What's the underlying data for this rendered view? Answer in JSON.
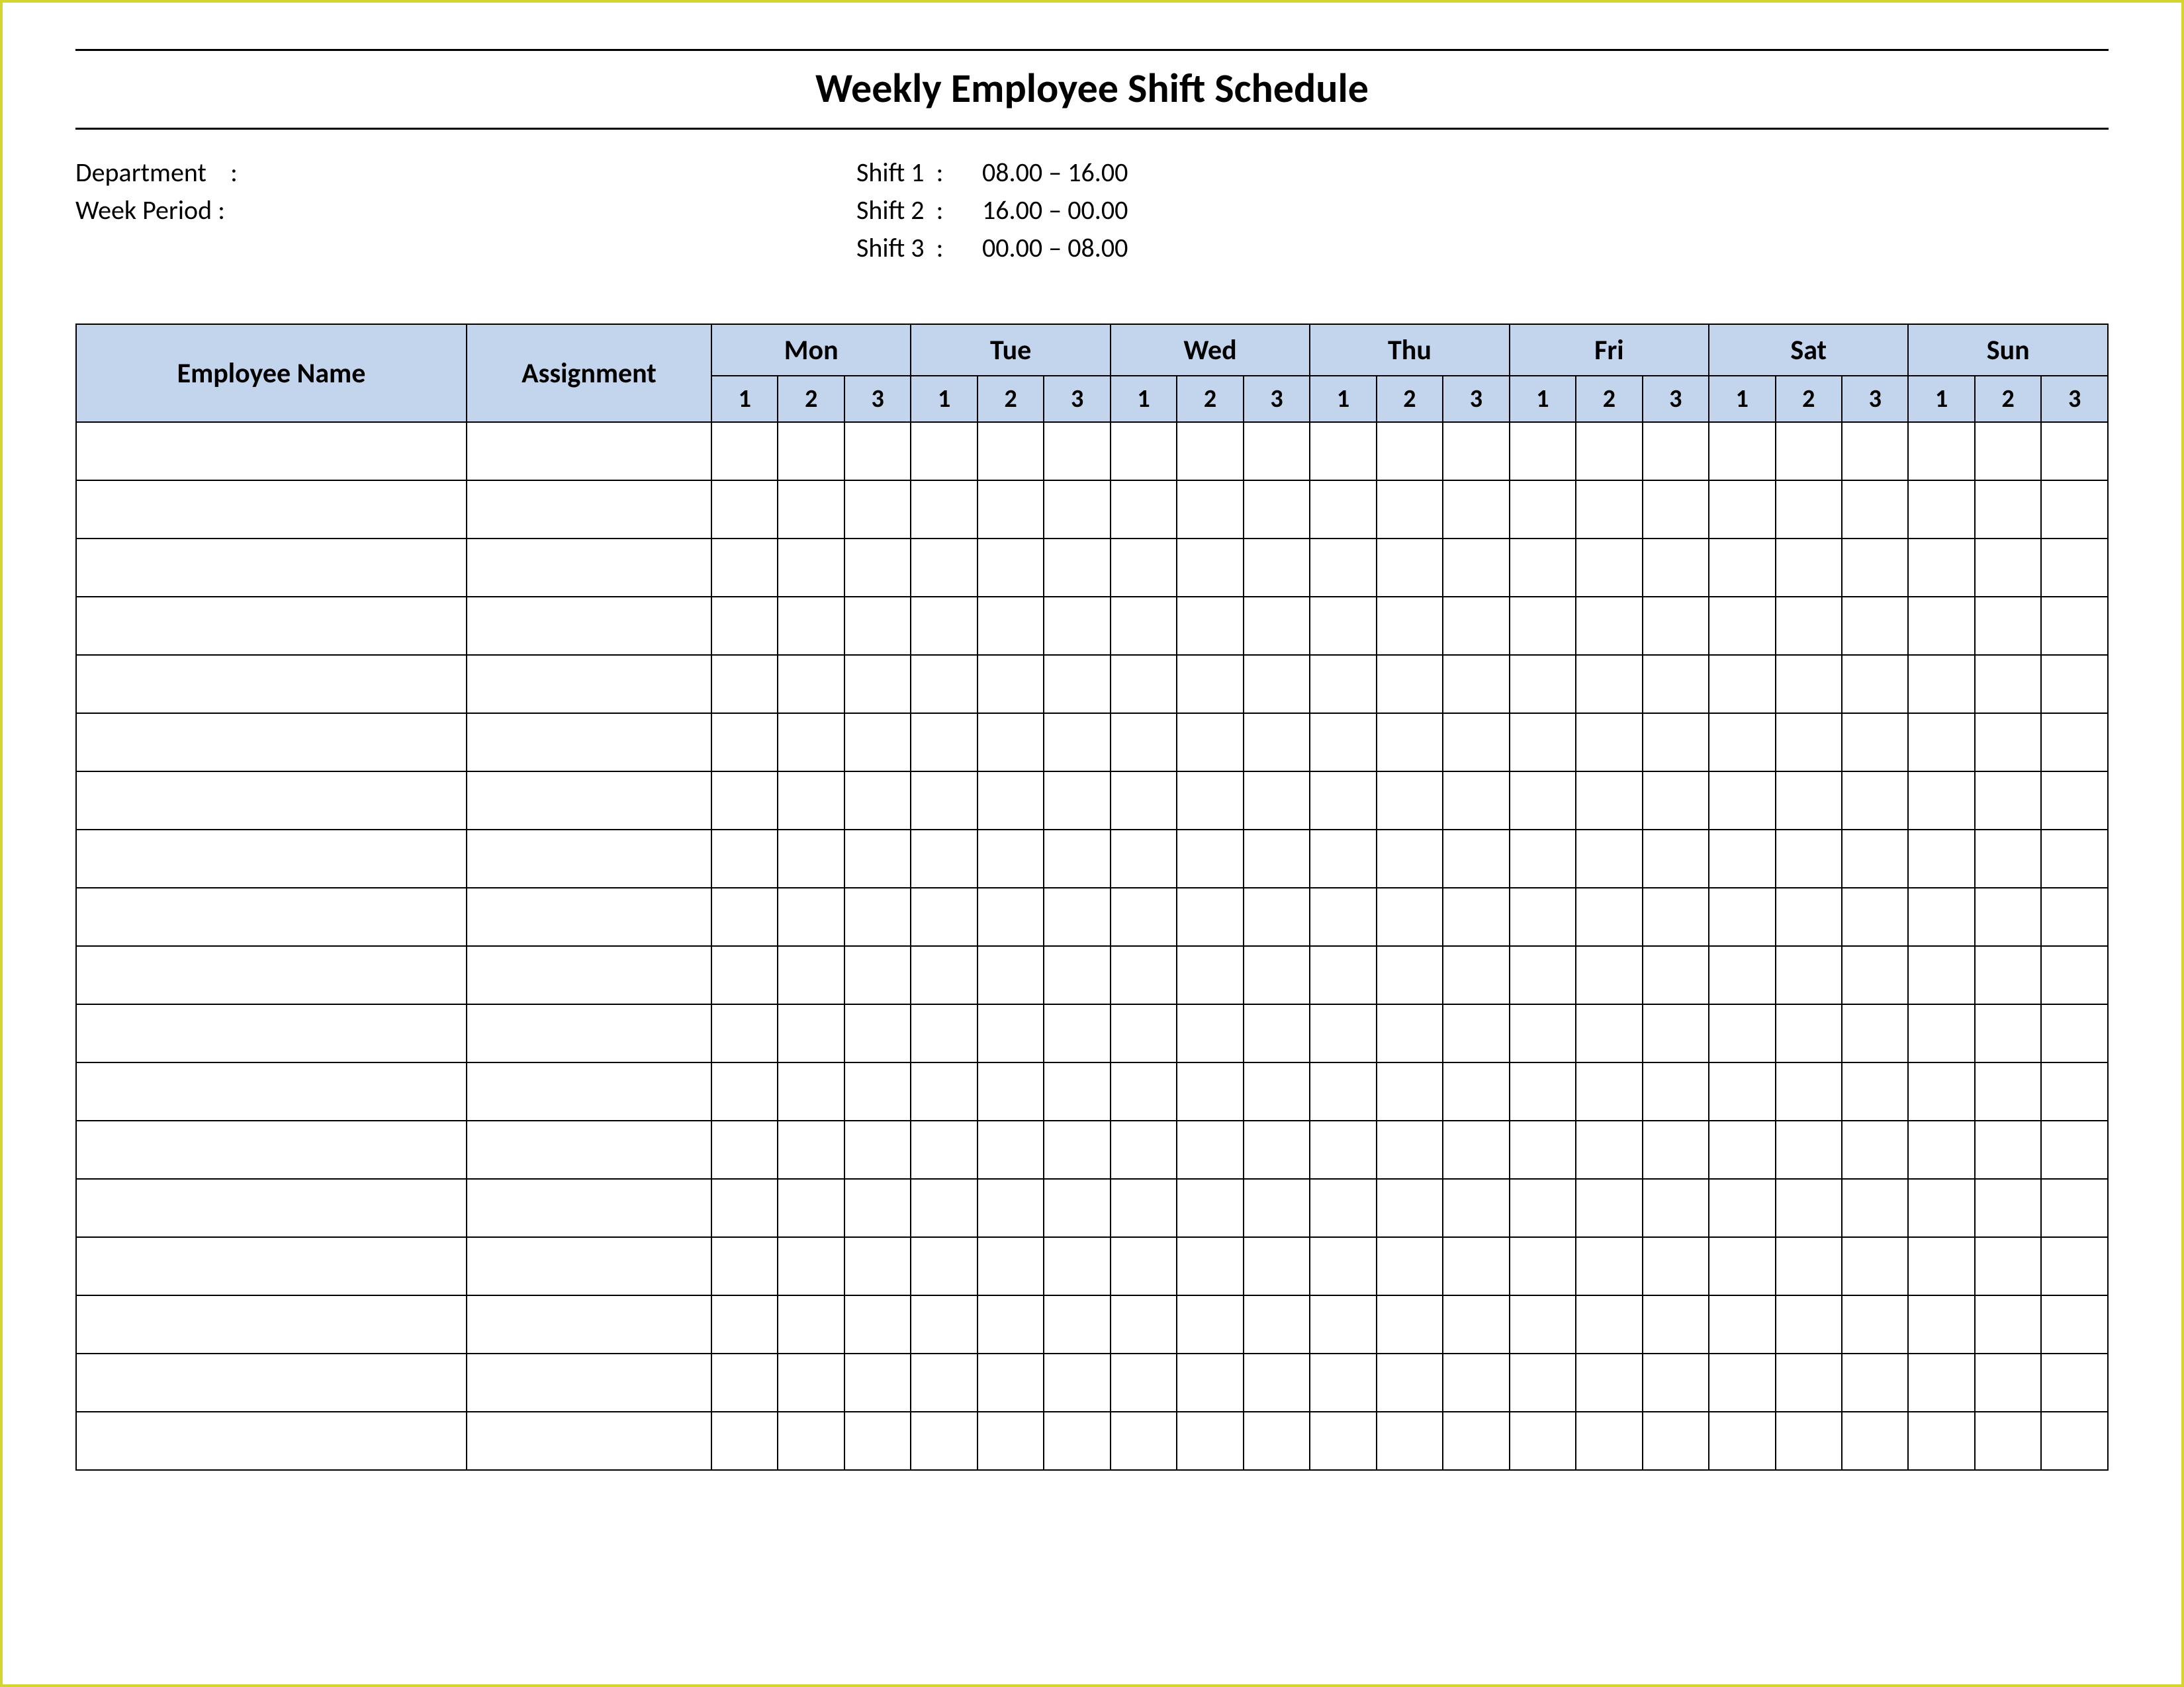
{
  "title": "Weekly Employee Shift Schedule",
  "meta": {
    "department_label": "Department",
    "department_value": "",
    "week_period_label": "Week  Period",
    "week_period_value": "",
    "shifts": [
      {
        "label": "Shift 1",
        "time": "08.00  – 16.00"
      },
      {
        "label": "Shift 2",
        "time": "16.00  – 00.00"
      },
      {
        "label": "Shift 3",
        "time": "00.00  – 08.00"
      }
    ]
  },
  "columns": {
    "employee_name": "Employee Name",
    "assignment": "Assignment",
    "days": [
      "Mon",
      "Tue",
      "Wed",
      "Thu",
      "Fri",
      "Sat",
      "Sun"
    ],
    "subshifts": [
      "1",
      "2",
      "3"
    ]
  },
  "rows": [
    {
      "name": "",
      "assignment": "",
      "cells": [
        "",
        "",
        "",
        "",
        "",
        "",
        "",
        "",
        "",
        "",
        "",
        "",
        "",
        "",
        "",
        "",
        "",
        "",
        "",
        "",
        ""
      ]
    },
    {
      "name": "",
      "assignment": "",
      "cells": [
        "",
        "",
        "",
        "",
        "",
        "",
        "",
        "",
        "",
        "",
        "",
        "",
        "",
        "",
        "",
        "",
        "",
        "",
        "",
        "",
        ""
      ]
    },
    {
      "name": "",
      "assignment": "",
      "cells": [
        "",
        "",
        "",
        "",
        "",
        "",
        "",
        "",
        "",
        "",
        "",
        "",
        "",
        "",
        "",
        "",
        "",
        "",
        "",
        "",
        ""
      ]
    },
    {
      "name": "",
      "assignment": "",
      "cells": [
        "",
        "",
        "",
        "",
        "",
        "",
        "",
        "",
        "",
        "",
        "",
        "",
        "",
        "",
        "",
        "",
        "",
        "",
        "",
        "",
        ""
      ]
    },
    {
      "name": "",
      "assignment": "",
      "cells": [
        "",
        "",
        "",
        "",
        "",
        "",
        "",
        "",
        "",
        "",
        "",
        "",
        "",
        "",
        "",
        "",
        "",
        "",
        "",
        "",
        ""
      ]
    },
    {
      "name": "",
      "assignment": "",
      "cells": [
        "",
        "",
        "",
        "",
        "",
        "",
        "",
        "",
        "",
        "",
        "",
        "",
        "",
        "",
        "",
        "",
        "",
        "",
        "",
        "",
        ""
      ]
    },
    {
      "name": "",
      "assignment": "",
      "cells": [
        "",
        "",
        "",
        "",
        "",
        "",
        "",
        "",
        "",
        "",
        "",
        "",
        "",
        "",
        "",
        "",
        "",
        "",
        "",
        "",
        ""
      ]
    },
    {
      "name": "",
      "assignment": "",
      "cells": [
        "",
        "",
        "",
        "",
        "",
        "",
        "",
        "",
        "",
        "",
        "",
        "",
        "",
        "",
        "",
        "",
        "",
        "",
        "",
        "",
        ""
      ]
    },
    {
      "name": "",
      "assignment": "",
      "cells": [
        "",
        "",
        "",
        "",
        "",
        "",
        "",
        "",
        "",
        "",
        "",
        "",
        "",
        "",
        "",
        "",
        "",
        "",
        "",
        "",
        ""
      ]
    },
    {
      "name": "",
      "assignment": "",
      "cells": [
        "",
        "",
        "",
        "",
        "",
        "",
        "",
        "",
        "",
        "",
        "",
        "",
        "",
        "",
        "",
        "",
        "",
        "",
        "",
        "",
        ""
      ]
    },
    {
      "name": "",
      "assignment": "",
      "cells": [
        "",
        "",
        "",
        "",
        "",
        "",
        "",
        "",
        "",
        "",
        "",
        "",
        "",
        "",
        "",
        "",
        "",
        "",
        "",
        "",
        ""
      ]
    },
    {
      "name": "",
      "assignment": "",
      "cells": [
        "",
        "",
        "",
        "",
        "",
        "",
        "",
        "",
        "",
        "",
        "",
        "",
        "",
        "",
        "",
        "",
        "",
        "",
        "",
        "",
        ""
      ]
    },
    {
      "name": "",
      "assignment": "",
      "cells": [
        "",
        "",
        "",
        "",
        "",
        "",
        "",
        "",
        "",
        "",
        "",
        "",
        "",
        "",
        "",
        "",
        "",
        "",
        "",
        "",
        ""
      ]
    },
    {
      "name": "",
      "assignment": "",
      "cells": [
        "",
        "",
        "",
        "",
        "",
        "",
        "",
        "",
        "",
        "",
        "",
        "",
        "",
        "",
        "",
        "",
        "",
        "",
        "",
        "",
        ""
      ]
    },
    {
      "name": "",
      "assignment": "",
      "cells": [
        "",
        "",
        "",
        "",
        "",
        "",
        "",
        "",
        "",
        "",
        "",
        "",
        "",
        "",
        "",
        "",
        "",
        "",
        "",
        "",
        ""
      ]
    },
    {
      "name": "",
      "assignment": "",
      "cells": [
        "",
        "",
        "",
        "",
        "",
        "",
        "",
        "",
        "",
        "",
        "",
        "",
        "",
        "",
        "",
        "",
        "",
        "",
        "",
        "",
        ""
      ]
    },
    {
      "name": "",
      "assignment": "",
      "cells": [
        "",
        "",
        "",
        "",
        "",
        "",
        "",
        "",
        "",
        "",
        "",
        "",
        "",
        "",
        "",
        "",
        "",
        "",
        "",
        "",
        ""
      ]
    },
    {
      "name": "",
      "assignment": "",
      "cells": [
        "",
        "",
        "",
        "",
        "",
        "",
        "",
        "",
        "",
        "",
        "",
        "",
        "",
        "",
        "",
        "",
        "",
        "",
        "",
        "",
        ""
      ]
    }
  ]
}
